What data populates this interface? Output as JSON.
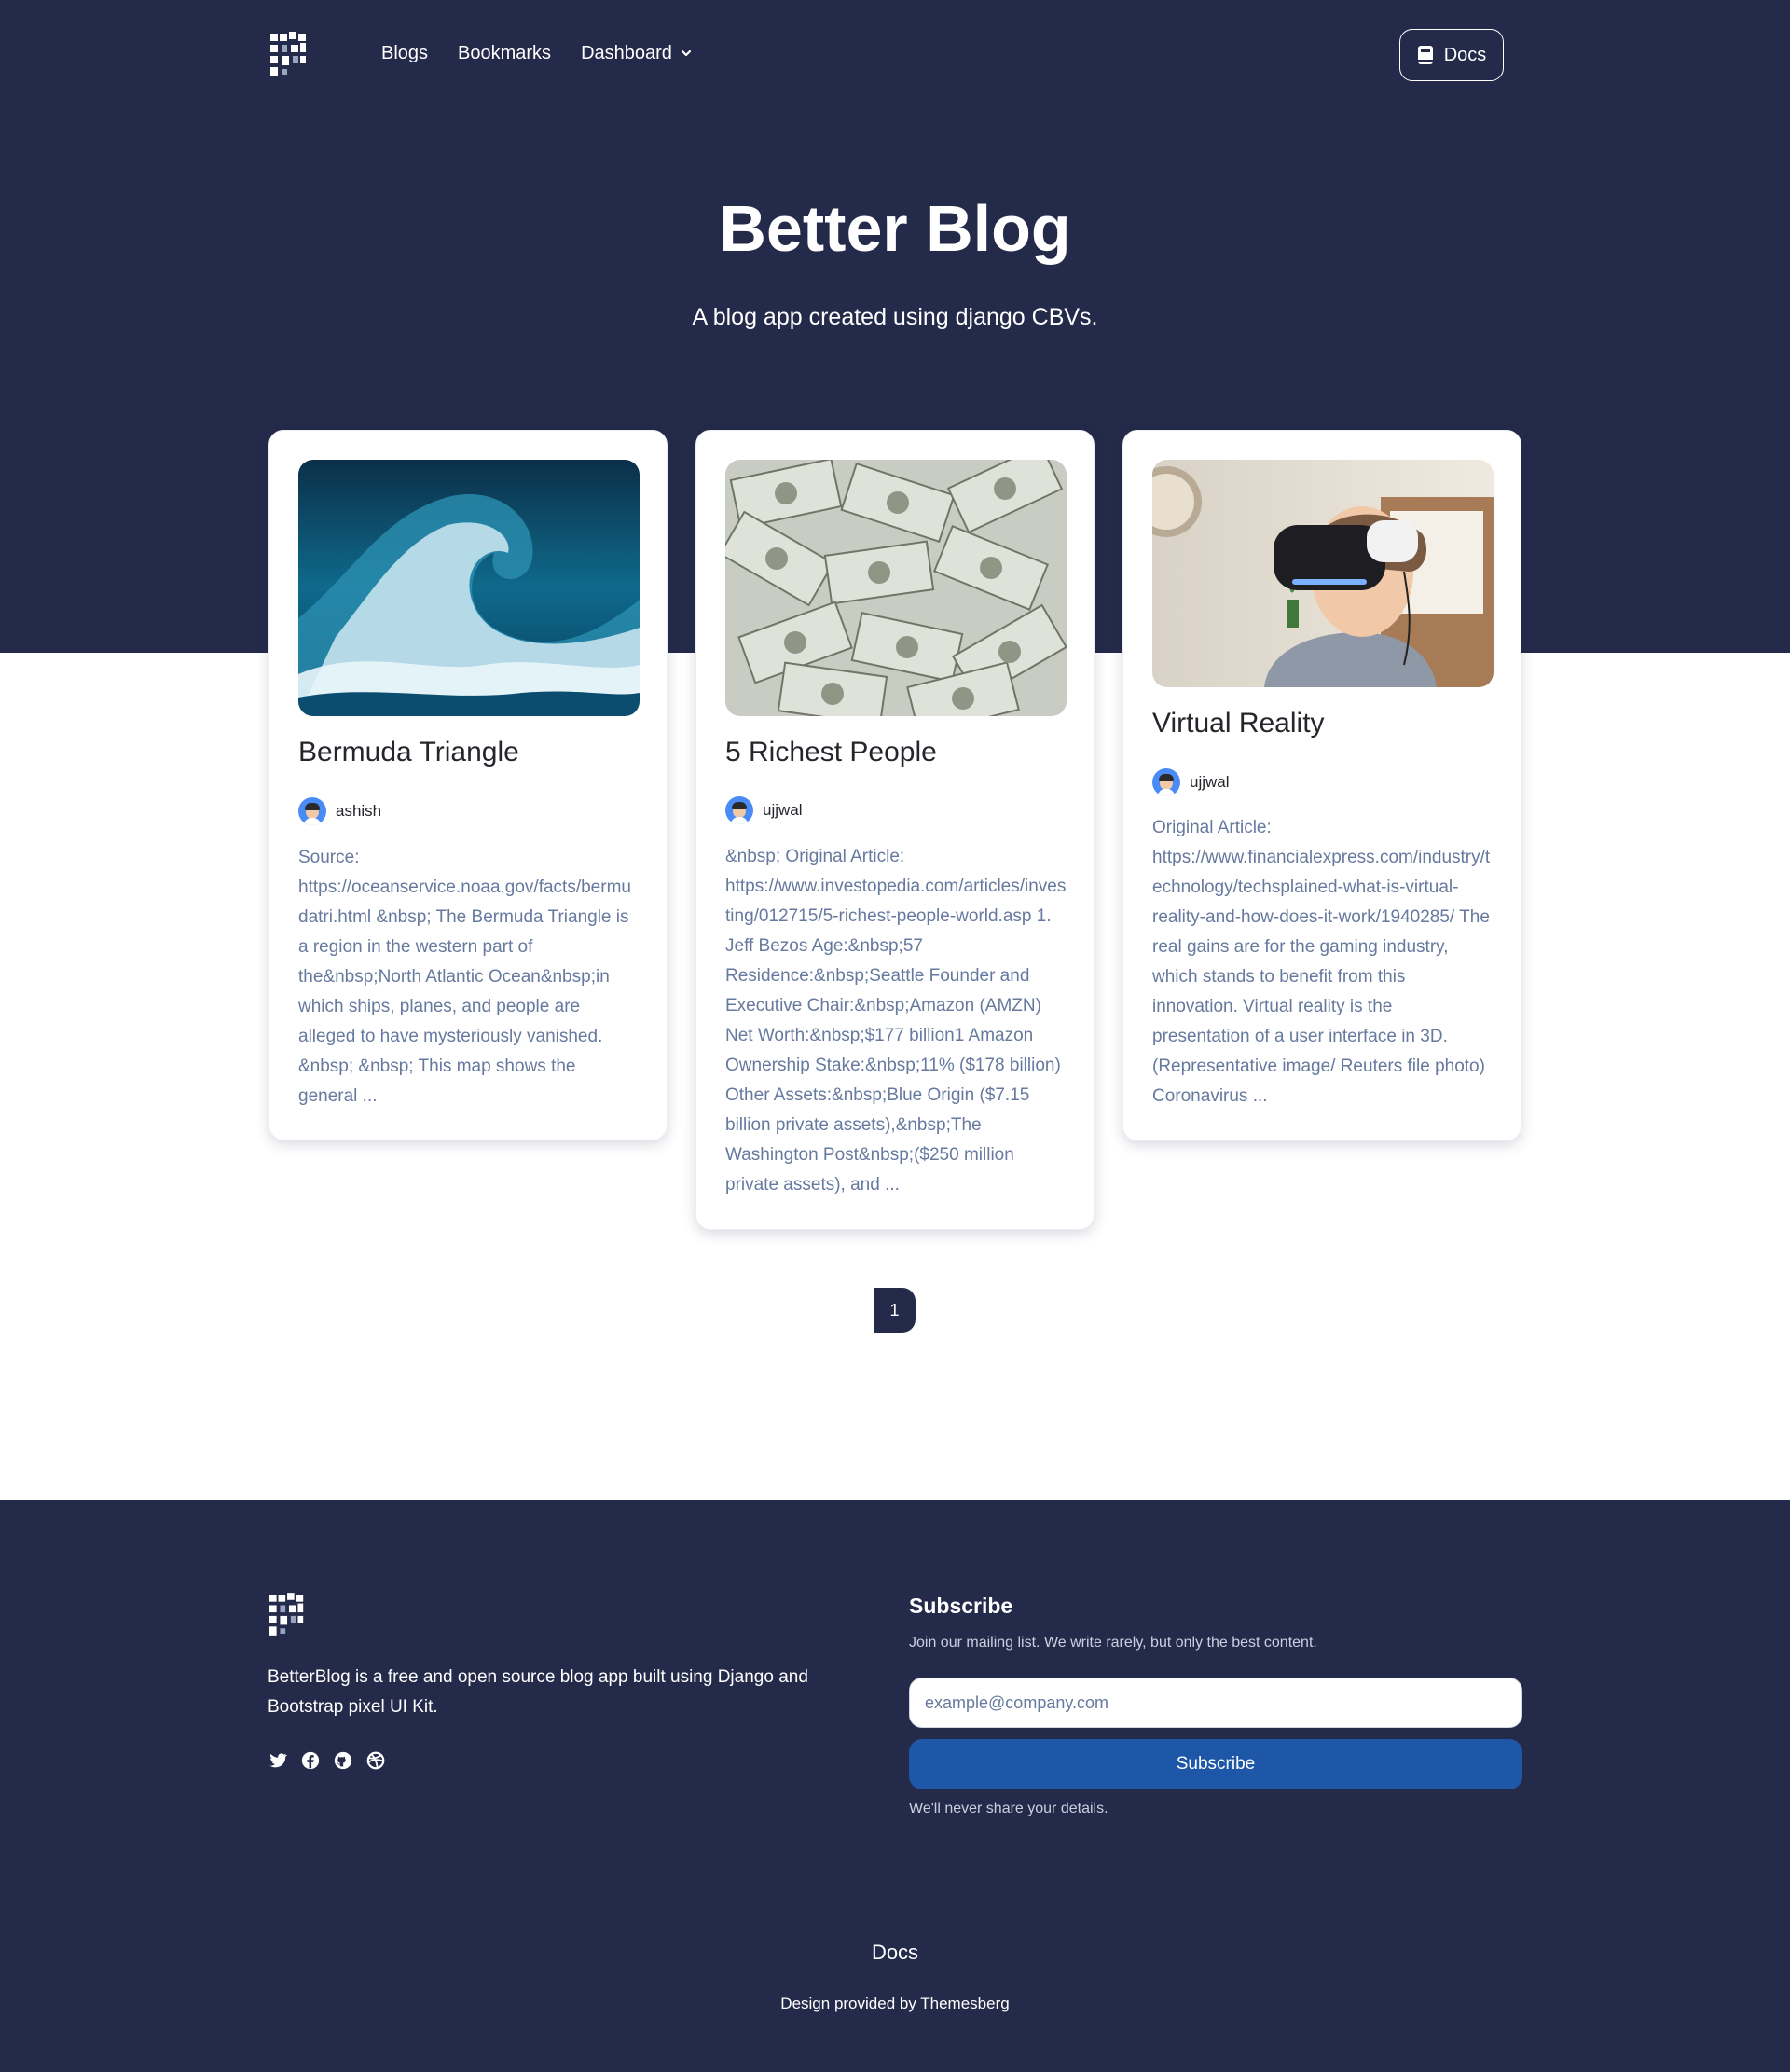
{
  "nav": {
    "links": [
      {
        "label": "Blogs"
      },
      {
        "label": "Bookmarks"
      },
      {
        "label": "Dashboard"
      }
    ],
    "docs_label": "Docs"
  },
  "hero": {
    "title": "Better Blog",
    "subtitle": "A blog app created using django CBVs."
  },
  "posts": [
    {
      "title": "Bermuda Triangle",
      "author": "ashish",
      "excerpt": "Source: https://oceanservice.noaa.gov/facts/bermudatri.html &nbsp; The Bermuda Triangle is a region in the western part of the&nbsp;North Atlantic Ocean&nbsp;in which ships, planes, and people are alleged to have mysteriously vanished. &nbsp; &nbsp; This map shows the general ..."
    },
    {
      "title": "5 Richest People",
      "author": "ujjwal",
      "excerpt": "&nbsp; Original Article: https://www.investopedia.com/articles/investing/012715/5-richest-people-world.asp 1. Jeff Bezos Age:&nbsp;57 Residence:&nbsp;Seattle Founder and Executive Chair:&nbsp;Amazon (AMZN) Net Worth:&nbsp;$177 billion1 Amazon Ownership Stake:&nbsp;11% ($178 billion) Other Assets:&nbsp;Blue Origin ($7.15 billion private assets),&nbsp;The Washington Post&nbsp;($250 million private assets), and ..."
    },
    {
      "title": "Virtual Reality",
      "author": "ujjwal",
      "excerpt": "Original Article: https://www.financialexpress.com/industry/technology/techsplained-what-is-virtual-reality-and-how-does-it-work/1940285/ The real gains are for the gaming industry, which stands to benefit from this innovation. Virtual reality is the presentation of a user interface in 3D. (Representative image/ Reuters file photo) Coronavirus ..."
    }
  ],
  "pagination": {
    "current": "1"
  },
  "footer": {
    "description": "BetterBlog is a free and open source blog app built using Django and Bootstrap pixel UI Kit.",
    "social_icons": [
      "twitter-icon",
      "facebook-icon",
      "github-icon",
      "dribbble-icon"
    ],
    "subscribe": {
      "title": "Subscribe",
      "description": "Join our mailing list. We write rarely, but only the best content.",
      "placeholder": "example@company.com",
      "button": "Subscribe",
      "note": "We'll never share your details."
    },
    "docs_link": "Docs",
    "credit_prefix": "Design provided by",
    "credit_link": "Themesberg"
  },
  "colors": {
    "primary": "#242a49",
    "subscribe_button": "#1f57a8",
    "muted_text": "#66799e"
  }
}
